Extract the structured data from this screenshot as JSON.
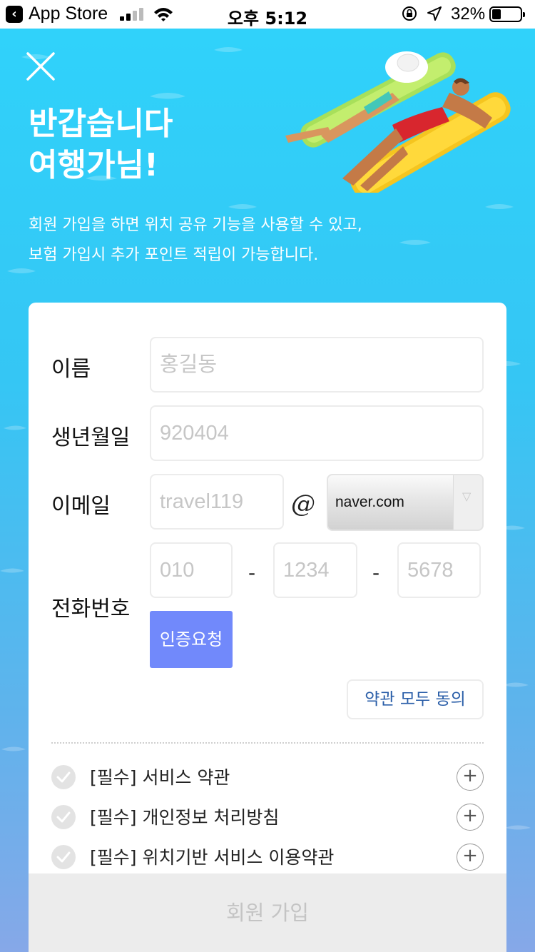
{
  "status_bar": {
    "back_app": "App Store",
    "time": "오후 5:12",
    "battery_percent": "32%",
    "battery_level": 0.32
  },
  "header": {
    "greeting_line1": "반갑습니다",
    "greeting_line2": "여행가님!",
    "description_line1": "회원 가입을 하면 위치 공유 기능을 사용할 수 있고,",
    "description_line2": "보험 가입시 추가 포인트 적립이 가능합니다."
  },
  "form": {
    "name": {
      "label": "이름",
      "placeholder": "홍길동"
    },
    "birth": {
      "label": "생년월일",
      "placeholder": "920404"
    },
    "email": {
      "label": "이메일",
      "id_placeholder": "travel119",
      "at": "@",
      "domain_selected": "naver.com"
    },
    "phone": {
      "label": "전화번호",
      "part1_placeholder": "010",
      "part2_placeholder": "1234",
      "part3_placeholder": "5678",
      "separator": "-",
      "verify_button": "인증요청"
    },
    "agree_all": "약관 모두 동의",
    "terms": [
      {
        "label": "[필수] 서비스 약관"
      },
      {
        "label": "[필수] 개인정보 처리방침"
      },
      {
        "label": "[필수] 위치기반 서비스 이용약관"
      }
    ],
    "submit": "회원 가입"
  },
  "colors": {
    "water_top": "#2fd3fb",
    "water_bottom": "#86a8e8",
    "verify_button": "#7189fb",
    "agree_text": "#2a5ea8",
    "submit_bg": "#ececec"
  },
  "icons": [
    "close-icon",
    "signal-icon",
    "wifi-icon",
    "rotation-lock-icon",
    "location-arrow-icon",
    "battery-icon",
    "check-icon",
    "plus-icon",
    "dropdown-arrow-icon"
  ]
}
